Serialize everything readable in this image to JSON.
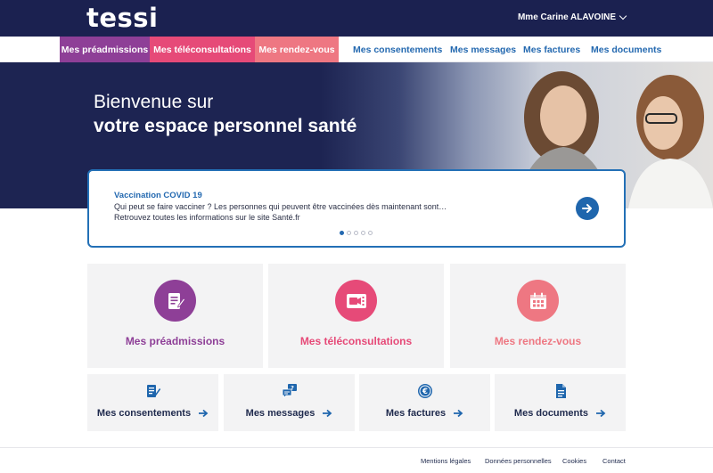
{
  "header": {
    "logo": "tessi",
    "user_name": "Mme Carine ALAVOINE"
  },
  "nav": {
    "preadmissions": "Mes préadmissions",
    "teleconsultations": "Mes téléconsultations",
    "rendezvous": "Mes rendez-vous",
    "consentements": "Mes consentements",
    "messages": "Mes messages",
    "factures": "Mes factures",
    "documents": "Mes documents"
  },
  "hero": {
    "line1": "Bienvenue sur",
    "line2": "votre espace personnel santé"
  },
  "news": {
    "title": "Vaccination COVID 19",
    "line1": "Qui peut se faire vacciner ? Les personnes qui peuvent être vaccinées dès maintenant sont…",
    "line2": "Retrouvez toutes les informations sur le site Santé.fr",
    "active_slide": 1,
    "slide_count": 5
  },
  "tiles": {
    "preadmissions": "Mes préadmissions",
    "teleconsultations": "Mes téléconsultations",
    "rendezvous": "Mes rendez-vous",
    "consentements": "Mes consentements",
    "messages": "Mes messages",
    "factures": "Mes factures",
    "documents": "Mes documents"
  },
  "colors": {
    "navy": "#1b2150",
    "purple": "#8e3f97",
    "pink": "#e64a78",
    "coral": "#ee7782",
    "blue": "#2469b0"
  },
  "footer": {
    "mentions": "Mentions légales",
    "donnees": "Données personnelles",
    "cookies": "Cookies",
    "contact": "Contact"
  }
}
